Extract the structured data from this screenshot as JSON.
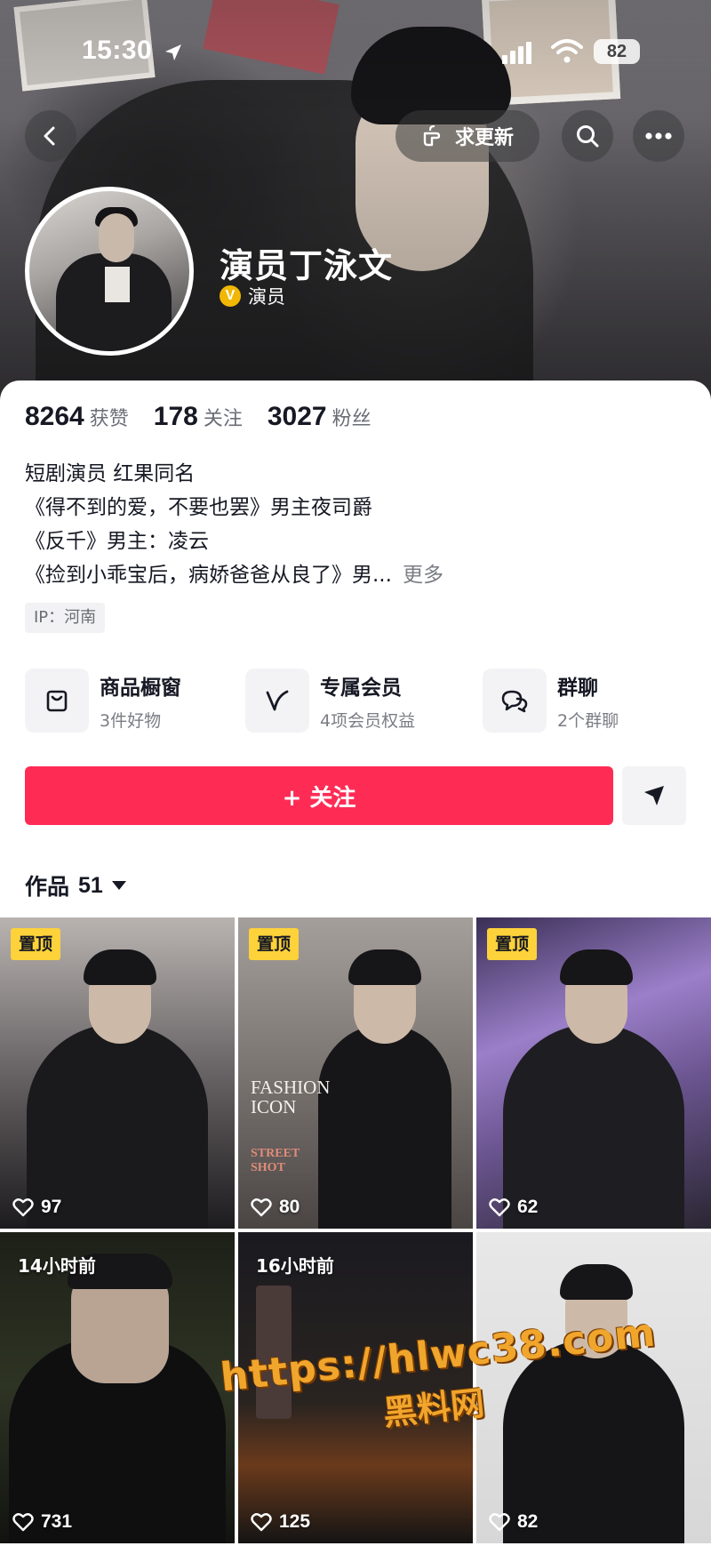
{
  "status_bar": {
    "time": "15:30",
    "battery": "82"
  },
  "header": {
    "request_update_label": "求更新"
  },
  "profile": {
    "name": "演员丁泳文",
    "verify_badge": "V",
    "verify_label": "演员",
    "stats": [
      {
        "value": "8264",
        "label": "获赞"
      },
      {
        "value": "178",
        "label": "关注"
      },
      {
        "value": "3027",
        "label": "粉丝"
      }
    ],
    "bio_lines": [
      "短剧演员  红果同名",
      "《得不到的爱，不要也罢》男主夜司爵",
      "《反千》男主：凌云",
      "《捡到小乖宝后，病娇爸爸从良了》男..."
    ],
    "bio_more": "更多",
    "ip": "IP：河南"
  },
  "services": [
    {
      "title": "商品橱窗",
      "subtitle": "3件好物",
      "icon": "shopping-bag-icon"
    },
    {
      "title": "专属会员",
      "subtitle": "4项会员权益",
      "icon": "membership-v-icon"
    },
    {
      "title": "群聊",
      "subtitle": "2个群聊",
      "icon": "group-chat-icon"
    }
  ],
  "actions": {
    "follow_label": "+ 关注"
  },
  "works": {
    "label": "作品",
    "count": "51"
  },
  "videos": [
    {
      "pinned": "置顶",
      "likes": "97"
    },
    {
      "pinned": "置顶",
      "likes": "80",
      "poster_title": "FASHION ICON",
      "poster_sub": "STREET SHOT"
    },
    {
      "pinned": "置顶",
      "likes": "62"
    },
    {
      "time": "14小时前",
      "likes": "731"
    },
    {
      "time": "16小时前",
      "likes": "125"
    },
    {
      "likes": "82"
    }
  ],
  "watermark": {
    "url": "https://hlwc38.com",
    "name": "黑料网"
  },
  "colors": {
    "accent": "#fe2c55",
    "pin": "#fdd23a",
    "verify": "#f2b705"
  }
}
